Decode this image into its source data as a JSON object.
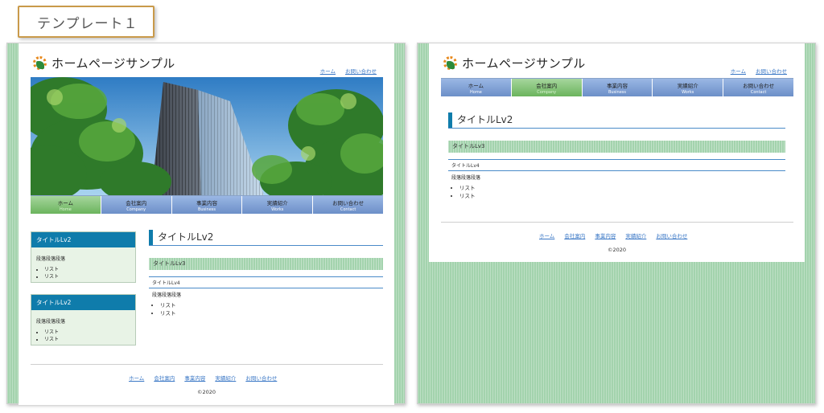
{
  "tag": {
    "label": "テンプレート１"
  },
  "site": {
    "title": "ホームページサンプル"
  },
  "toplinks": [
    "ホーム",
    "お問い合わせ"
  ],
  "nav": [
    {
      "jp": "ホーム",
      "en": "Home"
    },
    {
      "jp": "会社案内",
      "en": "Company"
    },
    {
      "jp": "事業内容",
      "en": "Business"
    },
    {
      "jp": "実績紹介",
      "en": "Works"
    },
    {
      "jp": "お問い合わせ",
      "en": "Contact"
    }
  ],
  "sidebar": {
    "boxes": [
      {
        "title": "タイトルLv2",
        "para": "段落段落段落",
        "items": [
          "リスト",
          "リスト"
        ]
      },
      {
        "title": "タイトルLv2",
        "para": "段落段落段落",
        "items": [
          "リスト",
          "リスト"
        ]
      }
    ]
  },
  "content": {
    "h2": "タイトルLv2",
    "h3": "タイトルLv3",
    "h4": "タイトルLv4",
    "para": "段落段落段落",
    "items": [
      "リスト",
      "リスト"
    ]
  },
  "footer": {
    "links": [
      "ホーム",
      "会社案内",
      "事業内容",
      "実績紹介",
      "お問い合わせ"
    ],
    "copyright": "©2020"
  },
  "colors": {
    "accent_blue": "#0f7cab",
    "nav_blue": "#7a9bd1",
    "nav_active_green": "#7dc06f",
    "pattern_green": "#a3d3ad",
    "link_blue": "#3b78c6",
    "tag_border": "#c99a4a"
  }
}
